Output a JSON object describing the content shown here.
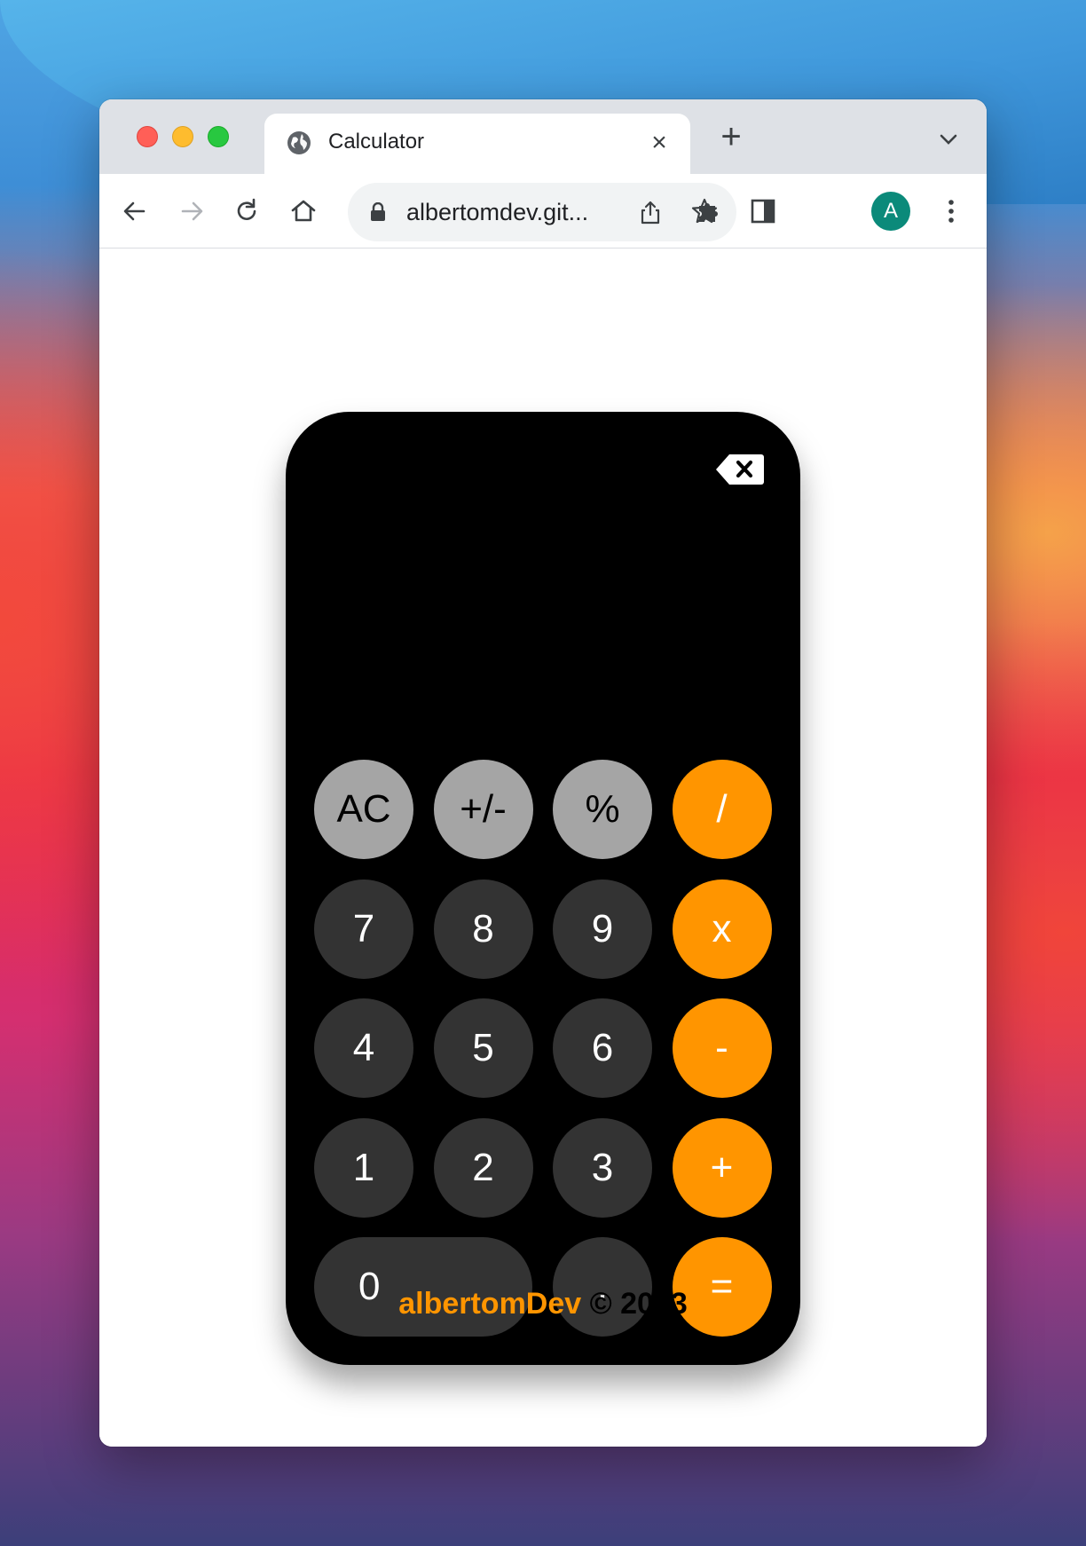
{
  "browser": {
    "tab": {
      "title": "Calculator"
    },
    "omnibox": {
      "url": "albertomdev.git..."
    },
    "profile": {
      "initial": "A",
      "color": "#0b8a7a"
    }
  },
  "calculator": {
    "display": "",
    "colors": {
      "function": "#a5a5a5",
      "number": "#333333",
      "operator": "#ff9500",
      "body": "#000000"
    },
    "keys": [
      {
        "label": "AC",
        "type": "function"
      },
      {
        "label": "+/-",
        "type": "function"
      },
      {
        "label": "%",
        "type": "function"
      },
      {
        "label": "/",
        "type": "operator"
      },
      {
        "label": "7",
        "type": "number"
      },
      {
        "label": "8",
        "type": "number"
      },
      {
        "label": "9",
        "type": "number"
      },
      {
        "label": "x",
        "type": "operator"
      },
      {
        "label": "4",
        "type": "number"
      },
      {
        "label": "5",
        "type": "number"
      },
      {
        "label": "6",
        "type": "number"
      },
      {
        "label": "-",
        "type": "operator"
      },
      {
        "label": "1",
        "type": "number"
      },
      {
        "label": "2",
        "type": "number"
      },
      {
        "label": "3",
        "type": "number"
      },
      {
        "label": "+",
        "type": "operator"
      },
      {
        "label": "0",
        "type": "number"
      },
      {
        "label": ".",
        "type": "number"
      },
      {
        "label": "=",
        "type": "operator"
      }
    ]
  },
  "footer": {
    "brand": "albertomDev",
    "copyright": " © 2023"
  }
}
